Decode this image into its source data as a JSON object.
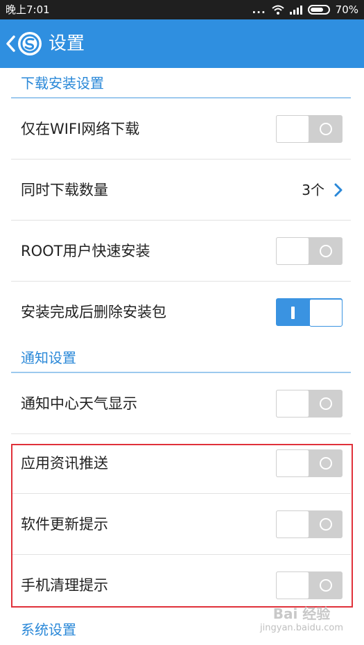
{
  "status_bar": {
    "time": "晚上7:01",
    "signal_dots": "...",
    "battery_text": "70%",
    "battery_level": 0.7
  },
  "app_bar": {
    "title": "设置",
    "color": "#2f8fe0"
  },
  "sections": {
    "download": {
      "title": "下载安装设置",
      "wifi_only": {
        "label": "仅在WIFI网络下载",
        "on": false
      },
      "concurrent": {
        "label": "同时下载数量",
        "value": "3个"
      },
      "root_install": {
        "label": "ROOT用户快速安装",
        "on": false
      },
      "delete_pkg": {
        "label": "安装完成后删除安装包",
        "on": true
      }
    },
    "notify": {
      "title": "通知设置",
      "weather": {
        "label": "通知中心天气显示",
        "on": false
      },
      "app_news": {
        "label": "应用资讯推送",
        "on": false
      },
      "update_tip": {
        "label": "软件更新提示",
        "on": false
      },
      "clean_tip": {
        "label": "手机清理提示",
        "on": false
      }
    },
    "system": {
      "title": "系统设置"
    }
  },
  "watermark": {
    "brand": "Bai 经验",
    "url": "jingyan.baidu.com"
  },
  "colors": {
    "accent": "#2a88d8",
    "toggle_on": "#3a93e1",
    "toggle_off": "#cfcfcf",
    "highlight": "#e0313a"
  }
}
